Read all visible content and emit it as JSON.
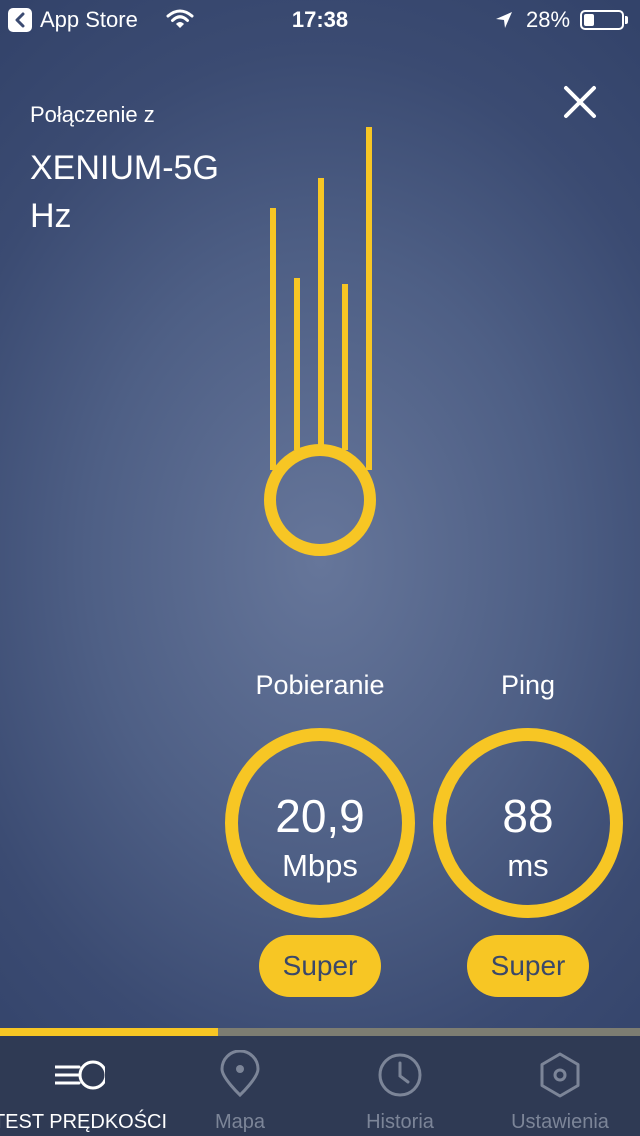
{
  "status_bar": {
    "back_app": "App Store",
    "time": "17:38",
    "battery": "28%",
    "battery_level": 0.28
  },
  "header": {
    "connection_label": "Połączenie z",
    "network_name": "XENIUM-5G Hz"
  },
  "results": {
    "download": {
      "label": "Pobieranie",
      "value": "20,9",
      "unit": "Mbps",
      "rating": "Super"
    },
    "ping": {
      "label": "Ping",
      "value": "88",
      "unit": "ms",
      "rating": "Super"
    }
  },
  "progress": 0.34,
  "tabs": [
    {
      "label": "TEST PRĘDKOŚCI",
      "icon": "speed-icon",
      "active": true
    },
    {
      "label": "Mapa",
      "icon": "map-pin-icon",
      "active": false
    },
    {
      "label": "Historia",
      "icon": "clock-icon",
      "active": false
    },
    {
      "label": "Ustawienia",
      "icon": "settings-hex-icon",
      "active": false
    }
  ],
  "colors": {
    "accent": "#f7c624",
    "background": "#4e5f85",
    "tabbar": "#2f3a54",
    "inactive_tab": "#7c8598"
  }
}
